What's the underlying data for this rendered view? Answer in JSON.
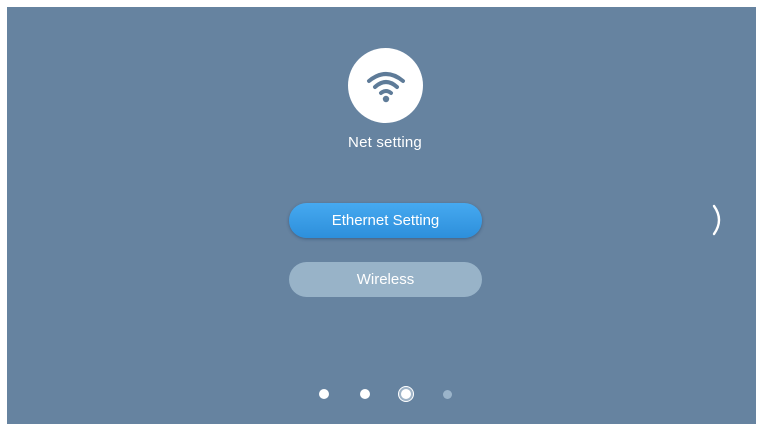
{
  "screen": {
    "title": "Net setting",
    "icon": "wifi-icon",
    "background_color": "#6683a0",
    "accent_color": "#3a9ae6"
  },
  "buttons": {
    "ethernet_label": "Ethernet Setting",
    "wireless_label": "Wireless"
  },
  "navigation": {
    "next_icon": "chevron-right-icon",
    "page_count": 4,
    "current_page": 3
  }
}
